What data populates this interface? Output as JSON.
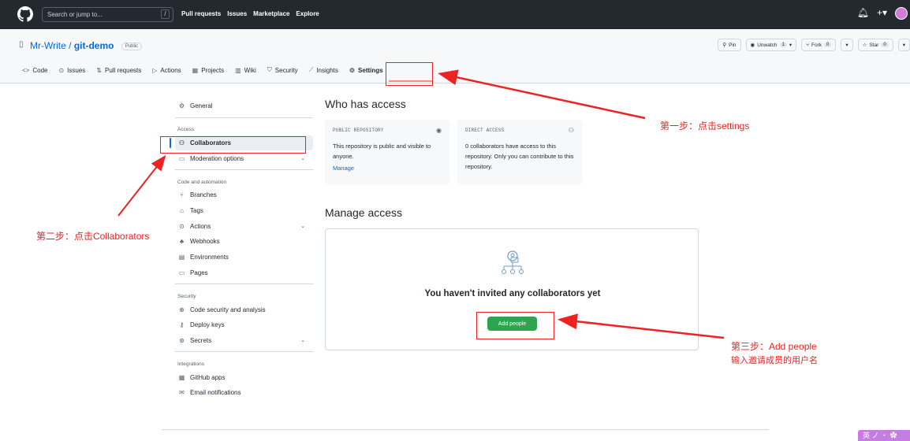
{
  "topbar": {
    "search_placeholder": "Search or jump to...",
    "search_shortcut": "/",
    "nav": [
      "Pull requests",
      "Issues",
      "Marketplace",
      "Explore"
    ],
    "icons": [
      "bell-icon",
      "plus-icon",
      "avatar"
    ]
  },
  "repo": {
    "owner": "Mr-Write",
    "separator": "/",
    "name": "git-demo",
    "visibility": "Public",
    "pin_label": "Pin",
    "watch_label": "Unwatch",
    "watch_count": "1",
    "fork_label": "Fork",
    "fork_count": "0",
    "star_label": "Star",
    "star_count": "0"
  },
  "tabs": [
    {
      "label": "Code",
      "icon": "code-icon"
    },
    {
      "label": "Issues",
      "icon": "issue-icon"
    },
    {
      "label": "Pull requests",
      "icon": "pr-icon"
    },
    {
      "label": "Actions",
      "icon": "play-icon"
    },
    {
      "label": "Projects",
      "icon": "table-icon"
    },
    {
      "label": "Wiki",
      "icon": "book-icon"
    },
    {
      "label": "Security",
      "icon": "shield-icon"
    },
    {
      "label": "Insights",
      "icon": "graph-icon"
    },
    {
      "label": "Settings",
      "icon": "gear-icon",
      "active": true
    }
  ],
  "sidebar": {
    "general": "General",
    "access_group": "Access",
    "collaborators": "Collaborators",
    "moderation": "Moderation options",
    "code_group": "Code and automation",
    "branches": "Branches",
    "tags": "Tags",
    "actions": "Actions",
    "webhooks": "Webhooks",
    "environments": "Environments",
    "pages": "Pages",
    "security_group": "Security",
    "code_security": "Code security and analysis",
    "deploy_keys": "Deploy keys",
    "secrets": "Secrets",
    "integrations_group": "Integrations",
    "github_apps": "GitHub apps",
    "email_notifications": "Email notifications"
  },
  "main": {
    "who_title": "Who has access",
    "public_card": {
      "label": "PUBLIC REPOSITORY",
      "text": "This repository is public and visible to anyone.",
      "link": "Manage"
    },
    "direct_card": {
      "label": "DIRECT ACCESS",
      "text": "0 collaborators have access to this repository. Only you can contribute to this repository."
    },
    "manage_title": "Manage access",
    "empty_text": "You haven't invited any collaborators yet",
    "add_button": "Add people"
  },
  "annotations": {
    "step1": "第一步：点击settings",
    "step2": "第二步：点击Collaborators",
    "step3_line1": "第三步：Add people",
    "step3_line2": "输入邀请成员的用户名",
    "color": "#e22222"
  },
  "ime_bar": "英 ノ ・ ✿"
}
